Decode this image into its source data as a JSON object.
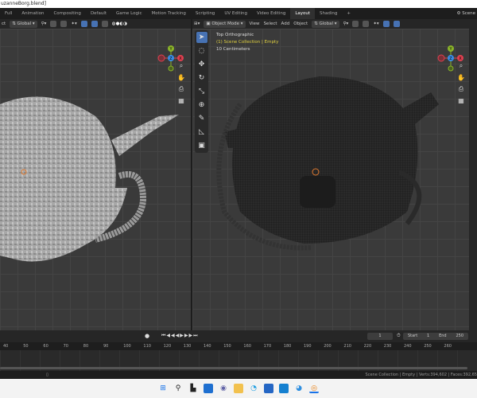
{
  "window": {
    "title": "uzanneBorg.blend]"
  },
  "workspace_tabs": [
    "Full",
    "Animation",
    "Compositing",
    "Default",
    "Game Logic",
    "Motion Tracking",
    "Scripting",
    "UV Editing",
    "Video Editing",
    "Layout",
    "Shading",
    "+"
  ],
  "active_tab": "Layout",
  "scene_label": "Scene",
  "left_header": {
    "select": "ct",
    "orientation": "Global"
  },
  "right_header": {
    "mode": "Object Mode",
    "menus": [
      "View",
      "Select",
      "Add",
      "Object"
    ],
    "orientation": "Global"
  },
  "overlay": {
    "view": "Top Orthographic",
    "collection": "(1) Scene Collection | Empty",
    "scale": "10 Centimeters"
  },
  "gizmo": {
    "y": "Y",
    "z": "Z",
    "x": "X"
  },
  "timeline": {
    "current_frame": "1",
    "start_label": "Start",
    "start": "1",
    "end_label": "End",
    "end": "250",
    "ruler": [
      "40",
      "50",
      "60",
      "70",
      "80",
      "90",
      "100",
      "110",
      "120",
      "130",
      "140",
      "150",
      "160",
      "170",
      "180",
      "190",
      "200",
      "210",
      "220",
      "230",
      "240",
      "250",
      "260"
    ]
  },
  "status": "Scene Collection | Empty | Verts:394,602 | Faces:392,65",
  "colors": {
    "accent": "#4772b3",
    "x_axis": "#e04050",
    "y_axis": "#8ab32a",
    "z_axis": "#3a8ee6",
    "overlay_yellow": "#e0d040"
  }
}
